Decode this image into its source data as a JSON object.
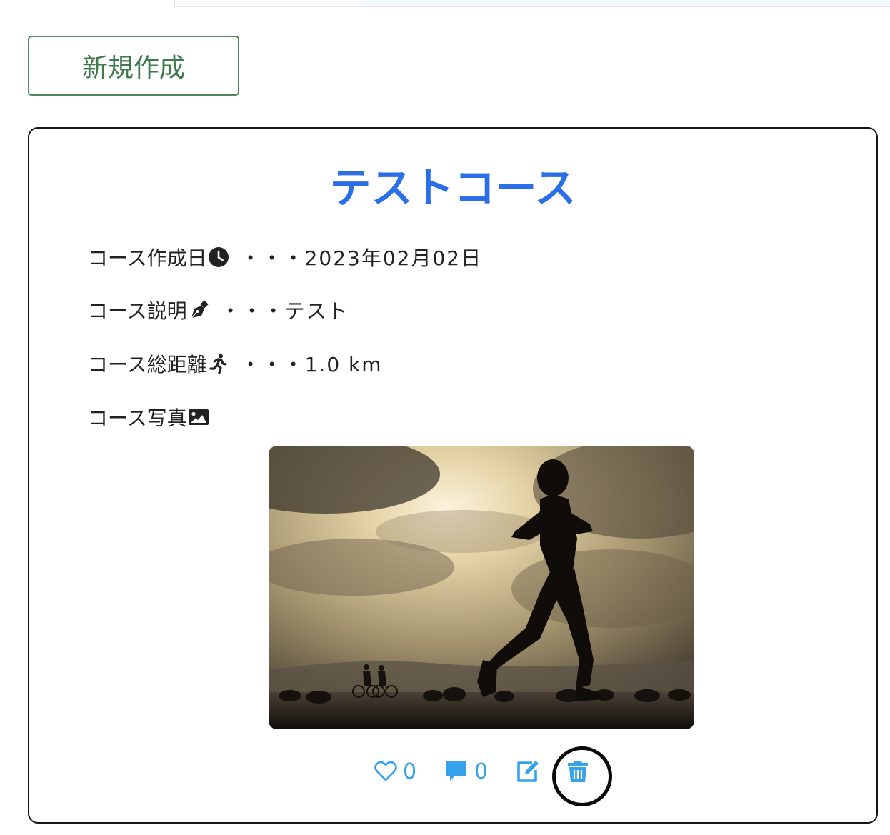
{
  "toolbar": {
    "new_label": "新規作成"
  },
  "course": {
    "title": "テストコース",
    "created_label": "コース作成日",
    "created_value": "・・・2023年02月02日",
    "description_label": "コース説明",
    "description_value": "・・・テスト",
    "distance_label": "コース総距離",
    "distance_value": "・・・1.0 km",
    "photo_label": "コース写真",
    "likes": "0",
    "comments": "0"
  },
  "icons": {
    "created": "clock-icon",
    "description": "pen-nib-icon",
    "distance": "running-person-icon",
    "photo": "image-icon",
    "like": "heart-outline-icon",
    "comment": "comment-icon",
    "edit": "edit-icon",
    "delete": "trash-icon"
  },
  "colors": {
    "title": "#2a6fe8",
    "action": "#36a2ea",
    "new_button": "#3d7a4d"
  }
}
